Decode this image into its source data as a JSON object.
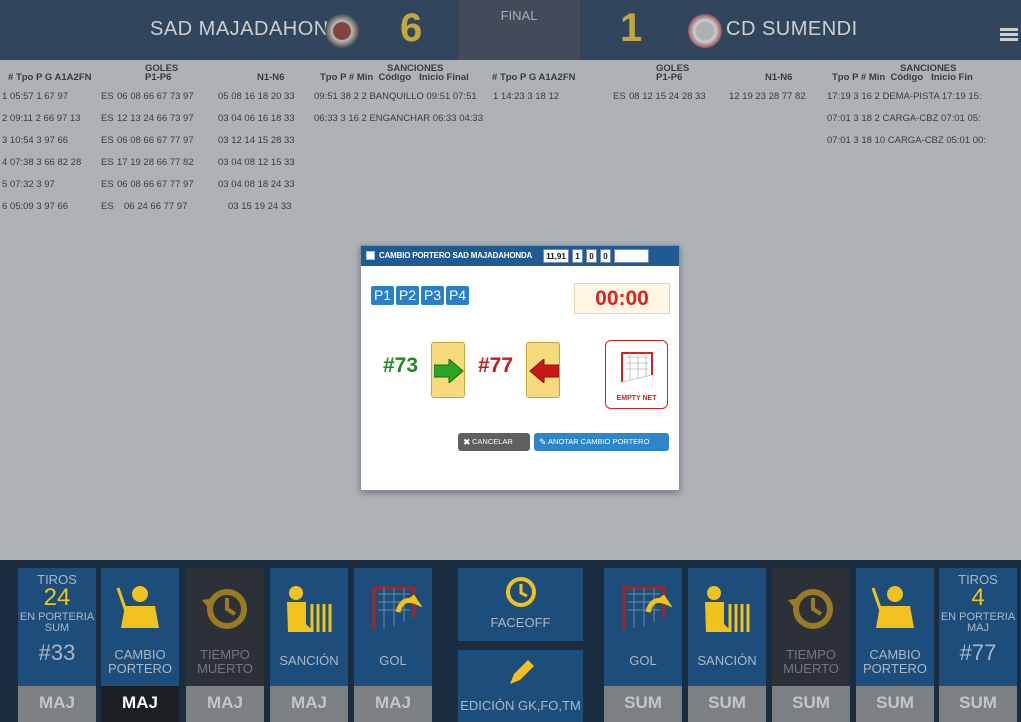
{
  "header": {
    "home_team": "SAD MAJADAHONDA",
    "home_score": "6",
    "status": "FINAL",
    "away_score": "1",
    "away_team": "CD SUMENDI"
  },
  "table": {
    "home": {
      "cols": [
        "#",
        "Tpo",
        "P",
        "G",
        "A1",
        "A2",
        "FN"
      ],
      "goles": "GOLES",
      "p1p6": "P1-P6",
      "n1n6": "N1-N6",
      "sanciones": "SANCIONES",
      "sanc_cols": [
        "Tpo",
        "P",
        "#",
        "Min",
        "Código",
        "Inicio",
        "Final"
      ],
      "rows": [
        {
          "a": "1 05:57 1 67 97",
          "fn": "ES",
          "p": "06 08 66 67 73 97",
          "n": "05 08 16 18 20 33",
          "s": "09:51 38 2  2  BANQUILLO 09:51 07:51"
        },
        {
          "a": "2 09:11 2 66 97 13",
          "fn": "ES",
          "p": "12 13 24 66 73 97",
          "n": "03 04 06 16 18 33",
          "s": "06:33 3 16  2  ENGANCHAR 06:33 04:33"
        },
        {
          "a": "3 10:54 3 97 66",
          "fn": "ES",
          "p": "06 08 66 67 77 97",
          "n": "03 12 14 15 28 33",
          "s": ""
        },
        {
          "a": "4 07:38 3 66 82 28",
          "fn": "ES",
          "p": "17 19 28 66 77 82",
          "n": "03 04 08 12 15 33",
          "s": ""
        },
        {
          "a": "5 07:32 3 97",
          "fn": "ES",
          "p": "06 08 66 67 77 97",
          "n": "03 04 08 18 24 33",
          "s": ""
        },
        {
          "a": "6 05:09 3 97 66",
          "fn": "ES",
          "p": "06 24 66 77 97",
          "n": "03 15 19 24 33",
          "s": ""
        }
      ]
    },
    "away": {
      "cols": [
        "#",
        "Tpo",
        "P",
        "G",
        "A1",
        "A2",
        "FN"
      ],
      "goles": "GOLES",
      "p1p6": "P1-P6",
      "n1n6": "N1-N6",
      "sanciones": "SANCIONES",
      "sanc_cols": [
        "Tpo",
        "P",
        "#",
        "Min",
        "Código",
        "Inicio",
        "Fin"
      ],
      "rows": [
        {
          "a": "1 14:23 3 18 12",
          "fn": "ES",
          "p": "08 12 15 24 28 33",
          "n": "12 19 23 28 77 82",
          "s": "17:19 3 16  2  DEMA-PISTA 17:19 15:"
        },
        {
          "a": "",
          "fn": "",
          "p": "",
          "n": "",
          "s": "07:01 3 18  2  CARGA-CBZ 07:01 05:"
        },
        {
          "a": "",
          "fn": "",
          "p": "",
          "n": "",
          "s": "07:01 3 18  10  CARGA-CBZ 05:01 00:"
        }
      ]
    }
  },
  "modal": {
    "title": "CAMBIO PORTERO SAD MAJADAHONDA",
    "fields": [
      "11,91",
      "1",
      "0",
      "0",
      ""
    ],
    "periods": [
      "P1",
      "P2",
      "P3",
      "P4"
    ],
    "clock": "00:00",
    "player_in": "#73",
    "player_out": "#77",
    "empty_net": "EMPTY NET",
    "cancel": "CANCELAR",
    "confirm": "ANOTAR CAMBIO PORTERO"
  },
  "toolbar": {
    "left_stat": {
      "label": "TIROS",
      "value": "24",
      "sub": "EN PORTERIA SUM",
      "player": "#33"
    },
    "right_stat": {
      "label": "TIROS",
      "value": "4",
      "sub": "EN PORTERIA MAJ",
      "player": "#77"
    },
    "home_actions": [
      "CAMBIO PORTERO",
      "TIEMPO MUERTO",
      "SANCIÓN",
      "GOL"
    ],
    "away_actions": [
      "GOL",
      "SANCIÓN",
      "TIEMPO MUERTO",
      "CAMBIO PORTERO"
    ],
    "faceoff": "FACEOFF",
    "edit": "EDICIÓN GK,FO,TM",
    "home_short": "MAJ",
    "away_short": "SUM"
  },
  "colors": {
    "header_bg": "#122d4b",
    "score": "#f1c21d",
    "tile": "#1d4e7b",
    "modal_bar": "#1e5b93",
    "clock": "#e31f1f"
  }
}
